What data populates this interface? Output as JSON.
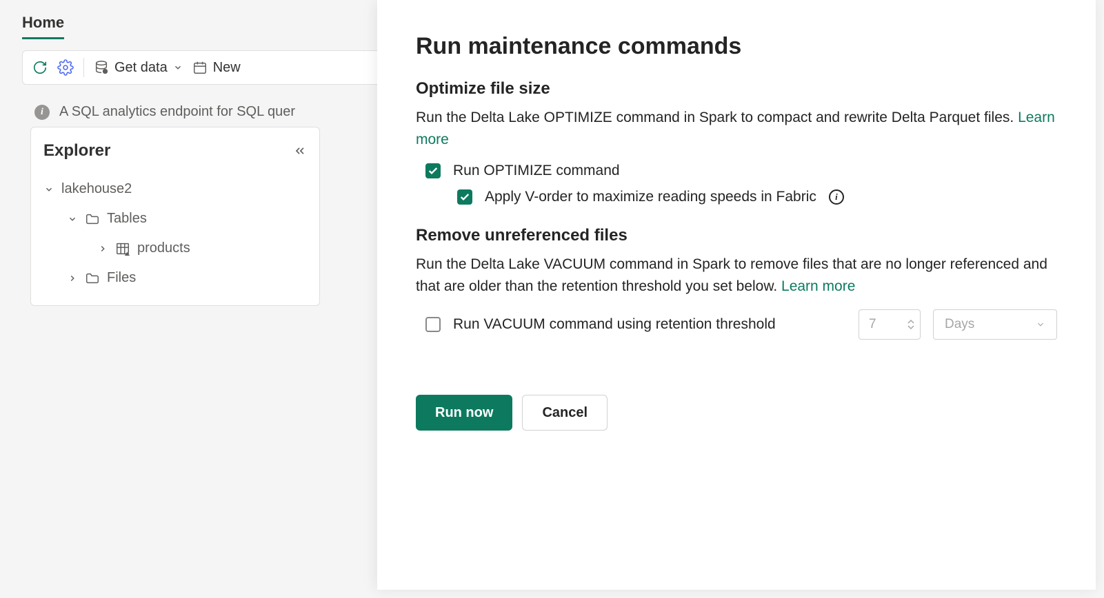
{
  "tabs": {
    "home": "Home"
  },
  "toolbar": {
    "get_data": "Get data",
    "new": "New"
  },
  "info_bar": {
    "text": "A SQL analytics endpoint for SQL quer"
  },
  "explorer": {
    "title": "Explorer",
    "root": "lakehouse2",
    "tables": "Tables",
    "products": "products",
    "files": "Files"
  },
  "panel": {
    "title": "Run maintenance commands",
    "optimize": {
      "heading": "Optimize file size",
      "desc": "Run the Delta Lake OPTIMIZE command in Spark to compact and rewrite Delta Parquet files. ",
      "learn_more": "Learn more",
      "cb1": "Run OPTIMIZE command",
      "cb2": "Apply V-order to maximize reading speeds in Fabric"
    },
    "remove": {
      "heading": "Remove unreferenced files",
      "desc": "Run the Delta Lake VACUUM command in Spark to remove files that are no longer referenced and that are older than the retention threshold you set below. ",
      "learn_more": "Learn more",
      "cb": "Run VACUUM command using retention threshold",
      "retention_value": "7",
      "retention_unit": "Days"
    },
    "actions": {
      "run": "Run now",
      "cancel": "Cancel"
    }
  }
}
